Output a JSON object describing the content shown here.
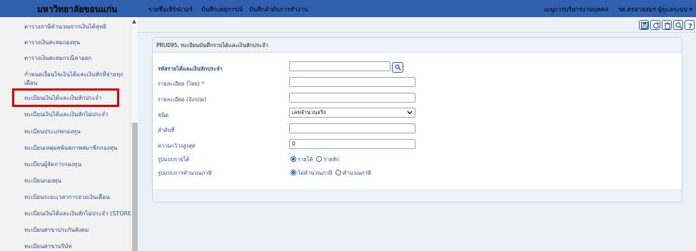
{
  "header": {
    "brand": "มหาวิทยาลัยขอนแก่น",
    "nav": [
      "รายชื่อเซิร์ฟเวอร์",
      "บันทึกเหตุการณ์",
      "บันทึกลำดับการทำงาน"
    ],
    "right_menu": "เมนูการบริหารงานบุคคล",
    "user_menu": "รศ.ดรสายสมร ผู้ดูแลระบบ ▾"
  },
  "sidebar": {
    "items": [
      "ตารางภาษีคำนวณจากเงินได้สุทธิ",
      "ตารางเงินสะสมกองทุน",
      "ตารางเงินสะสมกรณีลาออก",
      "กำหนดเงื่อนไขเงินได้และเงินหักที่จ่ายทุก",
      "เดือน",
      "ทะเบียนเงินได้และเงินหักประจำ",
      "ทะเบียนเงินได้และเงินหักไม่ประจำ",
      "ทะเบียนประเภทกองทุน",
      "ทะเบียนเหตุผลพ้นสภาพสมาชิกกองทุน",
      "ทะเบียนผู้จัดการกองทุน",
      "ทะเบียนกองทุน",
      "ทะเบียนระยะเวลาการจ่ายเงินเดือน",
      "ทะเบียนเงินได้และเงินหักไม่ประจำ (STORE)",
      "ทะเบียนสาขาประกันสังคม",
      "ทะเบียนสาขาบริษัท"
    ]
  },
  "toolbar": {
    "buttons": [
      "save-icon",
      "refresh-icon",
      "delete-icon",
      "search-icon",
      "help-icon"
    ]
  },
  "panel": {
    "title": "PRU095, ทะเบียนบันทึกรายได้และเงินหักประจำ"
  },
  "form": {
    "code_label": "รหัสรายได้และเงินหักประจำ",
    "code_value": "",
    "desc_th_label": "รายละเอียด (ไทย) *",
    "desc_th_value": "",
    "desc_en_label": "รายละเอียด (อังกฤษ)",
    "desc_en_value": "",
    "type_label": "ชนิด",
    "type_value": "เลขจำนวนจริง",
    "order_label": "ลำดับที่",
    "order_value": "",
    "width_label": "ความกว้างสูงสุด",
    "width_value": "0",
    "kind_label": "รูปแบบรายได้",
    "kind_options": [
      "รายได้",
      "รายหัก"
    ],
    "kind_selected": "รายได้",
    "tax_label": "รูปแบบการคำนวณภาษี",
    "tax_options": [
      "ไม่คำนวณภาษี",
      "คำนวณภาษี"
    ],
    "tax_selected": "ไม่คำนวณภาษี"
  },
  "colors": {
    "topbar": "#2f5faf",
    "sidebar_link": "#2b4f8c",
    "highlight": "#e00000",
    "content_bg": "#ecf1f8"
  }
}
